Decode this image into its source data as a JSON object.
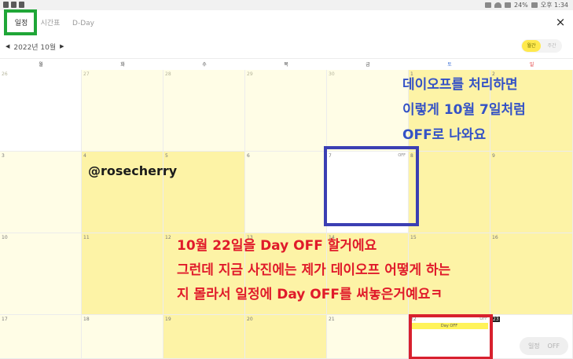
{
  "status_bar": {
    "battery": "24%",
    "time": "오후 1:34"
  },
  "tabs": [
    {
      "label": "일정",
      "active": true
    },
    {
      "label": "시간표",
      "active": false
    },
    {
      "label": "D-Day",
      "active": false
    }
  ],
  "close_label": "×",
  "month_nav": {
    "prev": "◀",
    "label": "2022년 10월",
    "next": "▶"
  },
  "week_toggle": {
    "left": "월간",
    "right": "주간"
  },
  "weekdays": [
    "월",
    "화",
    "수",
    "목",
    "금",
    "토",
    "일"
  ],
  "weeks": [
    [
      "26",
      "27",
      "28",
      "29",
      "30",
      "1",
      "2"
    ],
    [
      "3",
      "4",
      "5",
      "6",
      "7",
      "8",
      "9"
    ],
    [
      "10",
      "11",
      "12",
      "13",
      "14",
      "15",
      "16"
    ],
    [
      "17",
      "18",
      "19",
      "20",
      "21",
      "22",
      "23"
    ]
  ],
  "off_label": "OFF",
  "event_label": "Day OFF",
  "annotations": {
    "blue": [
      "데이오프를 처리하면",
      "이렇게 10월 7일처럼",
      "OFF로 나와요"
    ],
    "handle": "@rosecherry",
    "red": [
      "10월 22일을 Day OFF 할거에요",
      "그런데 지금 사진에는 제가 데이오프 어떻게 하는",
      "지 몰라서 일정에 Day OFF를 써놓은거예요ㅋ"
    ]
  },
  "bottom_toggle": {
    "left": "일정",
    "right": "OFF"
  },
  "colors": {
    "highlight": "#fdf3a6",
    "pale": "#fffde6",
    "green_box": "#1fa637",
    "blue_box": "#3b3fb3",
    "red_box": "#d8202e"
  }
}
